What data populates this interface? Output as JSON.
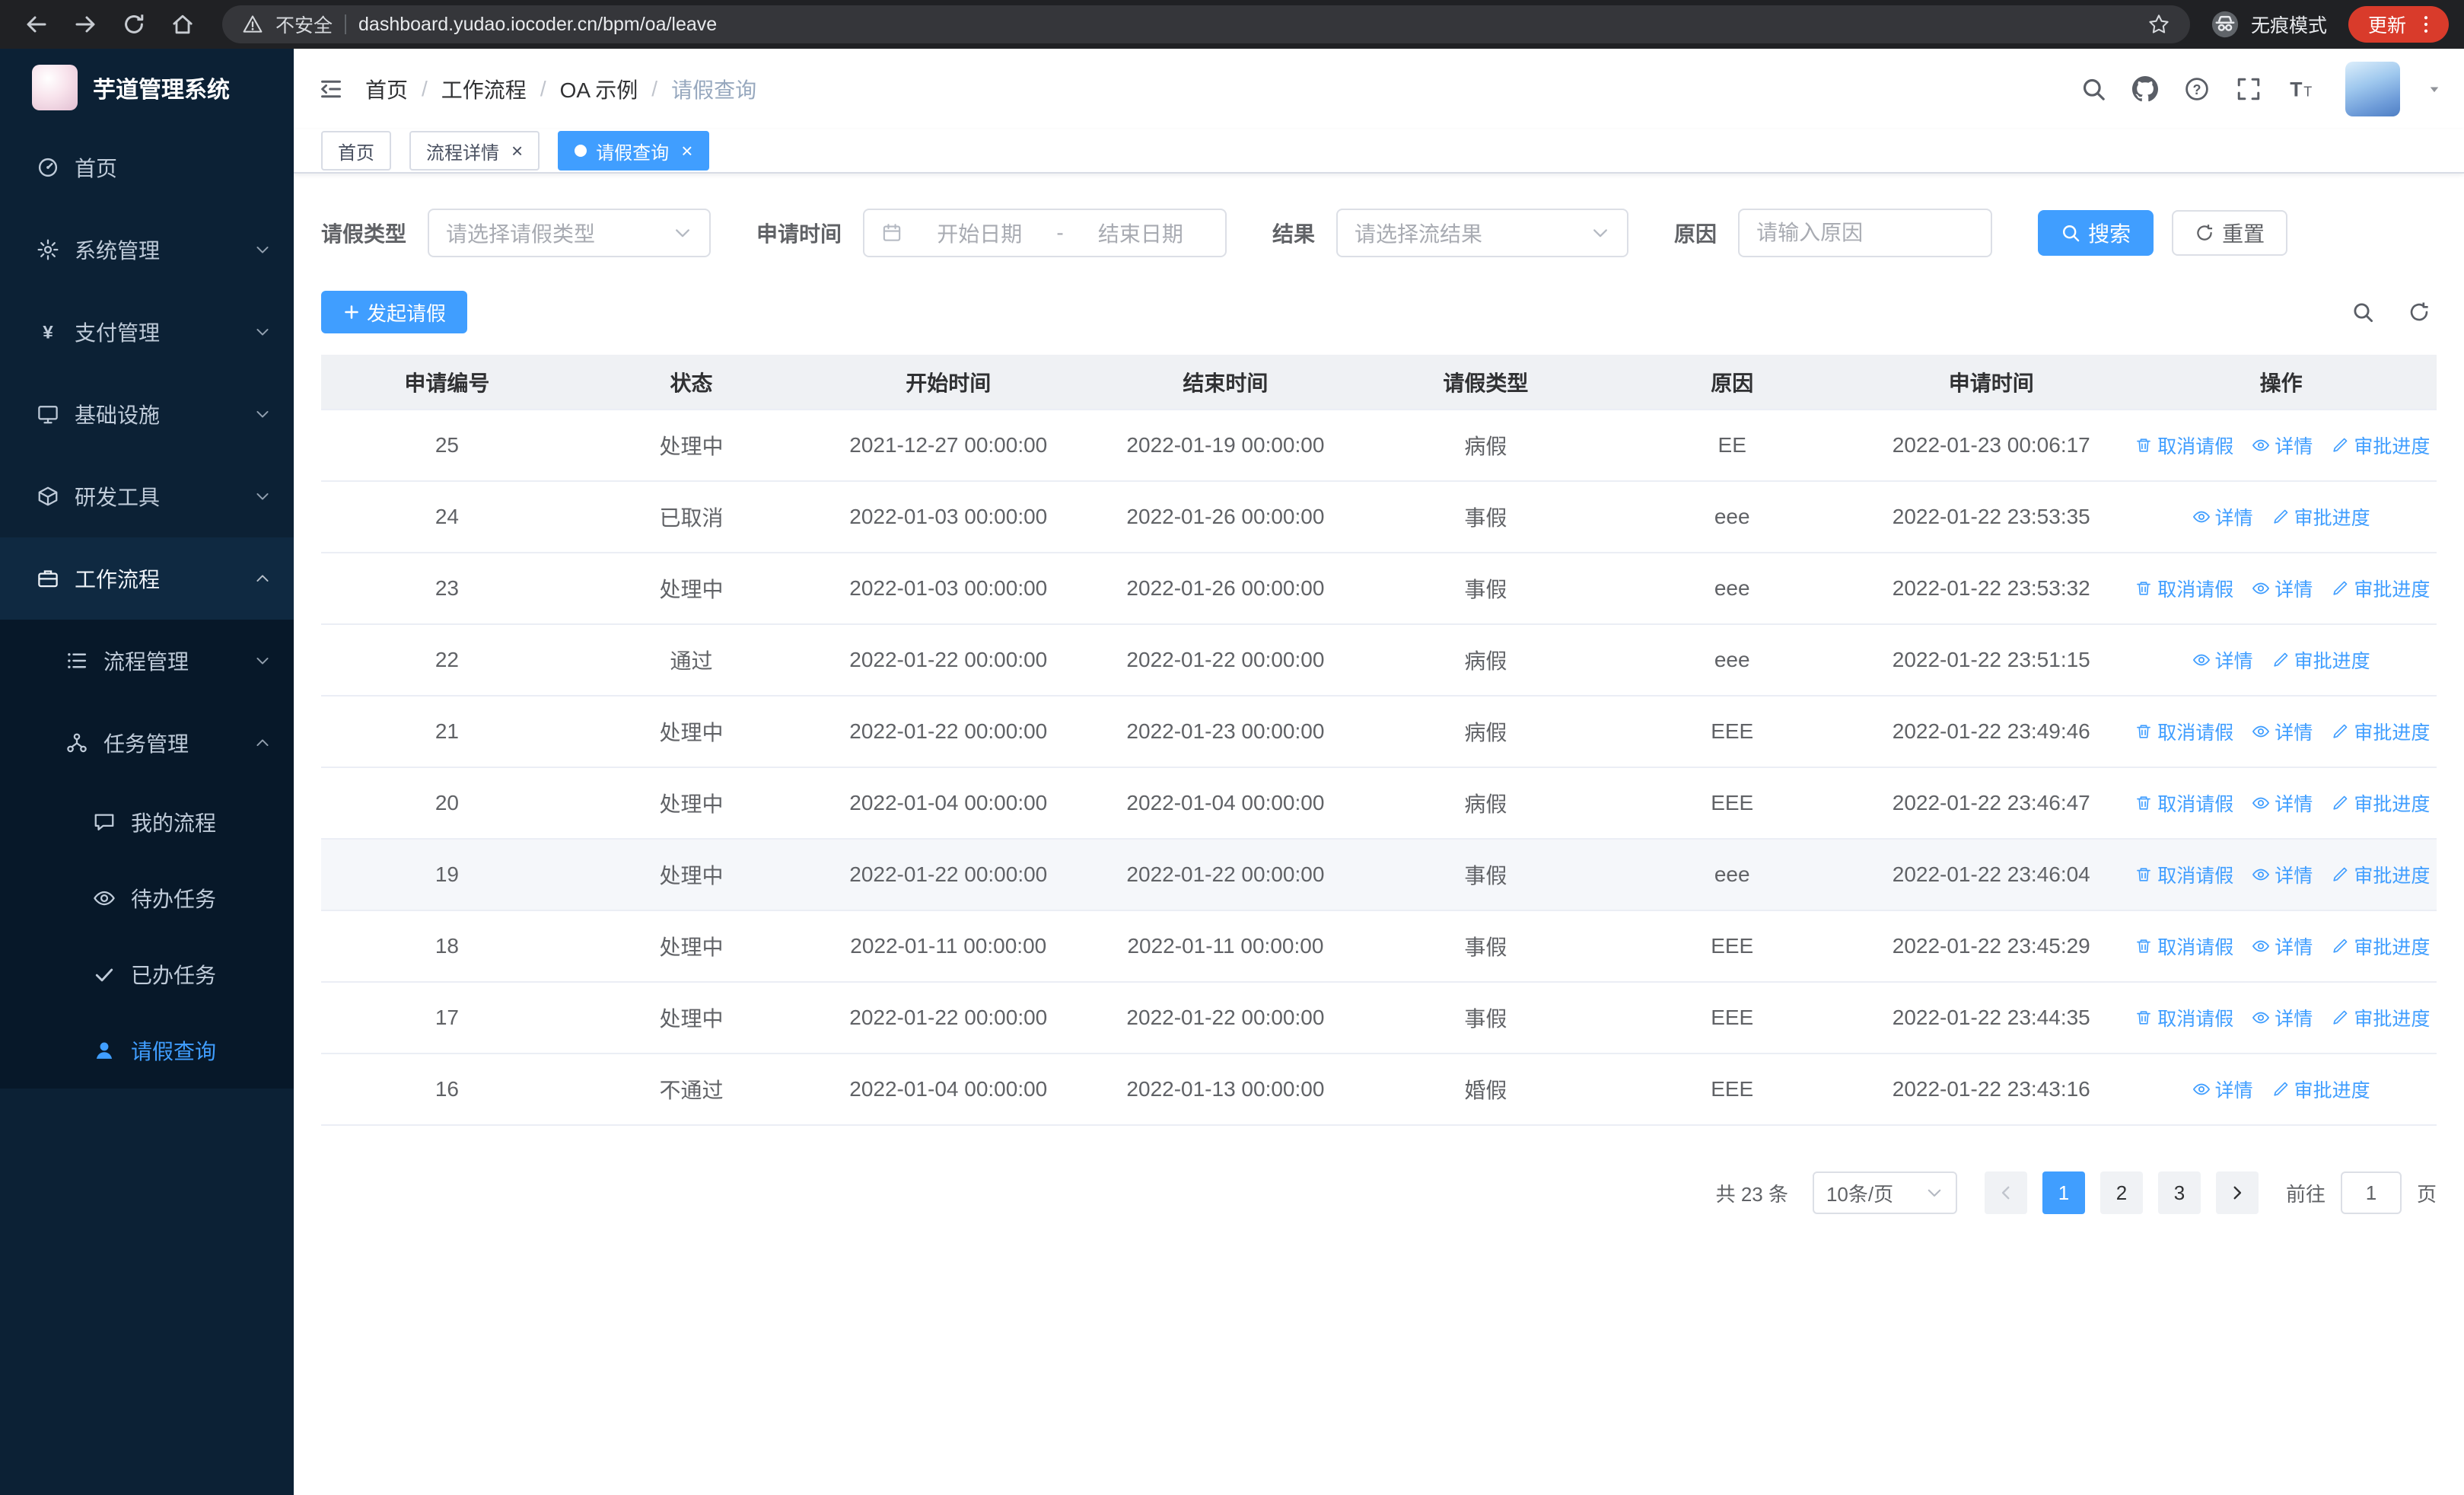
{
  "colors": {
    "primary": "#409eff",
    "sidebar_bg": "#0c2135",
    "sidebar_sub_bg": "#071829",
    "update_badge": "#d93b2b",
    "table_header_bg": "#eff1f4"
  },
  "browser": {
    "security_warning": "不安全",
    "url": "dashboard.yudao.iocoder.cn/bpm/oa/leave",
    "incognito_label": "无痕模式",
    "update_button": "更新"
  },
  "sidebar": {
    "app_title": "芋道管理系统",
    "menu": [
      {
        "label": "首页",
        "icon": "dashboard",
        "level": 0
      },
      {
        "label": "系统管理",
        "icon": "gear",
        "level": 0,
        "chevron": "down"
      },
      {
        "label": "支付管理",
        "icon": "yen",
        "level": 0,
        "chevron": "down"
      },
      {
        "label": "基础设施",
        "icon": "monitor",
        "level": 0,
        "chevron": "down"
      },
      {
        "label": "研发工具",
        "icon": "box",
        "level": 0,
        "chevron": "down"
      },
      {
        "label": "工作流程",
        "icon": "briefcase",
        "level": 0,
        "chevron": "up",
        "open": true
      },
      {
        "label": "流程管理",
        "icon": "list",
        "level": 1,
        "chevron": "down"
      },
      {
        "label": "任务管理",
        "icon": "task",
        "level": 1,
        "chevron": "up"
      },
      {
        "label": "我的流程",
        "icon": "chat",
        "level": 2
      },
      {
        "label": "待办任务",
        "icon": "eye",
        "level": 2
      },
      {
        "label": "已办任务",
        "icon": "check",
        "level": 2
      },
      {
        "label": "请假查询",
        "icon": "user",
        "level": 2,
        "active": true
      }
    ]
  },
  "header": {
    "breadcrumb": [
      "首页",
      "工作流程",
      "OA 示例",
      "请假查询"
    ]
  },
  "tabs": [
    {
      "label": "首页",
      "closable": false,
      "active": false
    },
    {
      "label": "流程详情",
      "closable": true,
      "active": false
    },
    {
      "label": "请假查询",
      "closable": true,
      "active": true
    }
  ],
  "filters": {
    "leave_type_label": "请假类型",
    "leave_type_placeholder": "请选择请假类型",
    "apply_time_label": "申请时间",
    "start_date_placeholder": "开始日期",
    "range_separator": "-",
    "end_date_placeholder": "结束日期",
    "result_label": "结果",
    "result_placeholder": "请选择流结果",
    "reason_label": "原因",
    "reason_placeholder": "请输入原因",
    "search_button": "搜索",
    "reset_button": "重置"
  },
  "toolbar": {
    "create_button": "发起请假"
  },
  "table": {
    "columns": [
      "申请编号",
      "状态",
      "开始时间",
      "结束时间",
      "请假类型",
      "原因",
      "申请时间",
      "操作"
    ],
    "action_defs": {
      "cancel": {
        "label": "取消请假",
        "icon": "trash"
      },
      "detail": {
        "label": "详情",
        "icon": "eye"
      },
      "progress": {
        "label": "审批进度",
        "icon": "edit"
      }
    },
    "rows": [
      {
        "id": "25",
        "status": "处理中",
        "start": "2021-12-27 00:00:00",
        "end": "2022-01-19 00:00:00",
        "type": "病假",
        "reason": "EE",
        "applied": "2022-01-23 00:06:17",
        "actions": [
          "cancel",
          "detail",
          "progress"
        ]
      },
      {
        "id": "24",
        "status": "已取消",
        "start": "2022-01-03 00:00:00",
        "end": "2022-01-26 00:00:00",
        "type": "事假",
        "reason": "eee",
        "applied": "2022-01-22 23:53:35",
        "actions": [
          "detail",
          "progress"
        ]
      },
      {
        "id": "23",
        "status": "处理中",
        "start": "2022-01-03 00:00:00",
        "end": "2022-01-26 00:00:00",
        "type": "事假",
        "reason": "eee",
        "applied": "2022-01-22 23:53:32",
        "actions": [
          "cancel",
          "detail",
          "progress"
        ]
      },
      {
        "id": "22",
        "status": "通过",
        "start": "2022-01-22 00:00:00",
        "end": "2022-01-22 00:00:00",
        "type": "病假",
        "reason": "eee",
        "applied": "2022-01-22 23:51:15",
        "actions": [
          "detail",
          "progress"
        ]
      },
      {
        "id": "21",
        "status": "处理中",
        "start": "2022-01-22 00:00:00",
        "end": "2022-01-23 00:00:00",
        "type": "病假",
        "reason": "EEE",
        "applied": "2022-01-22 23:49:46",
        "actions": [
          "cancel",
          "detail",
          "progress"
        ]
      },
      {
        "id": "20",
        "status": "处理中",
        "start": "2022-01-04 00:00:00",
        "end": "2022-01-04 00:00:00",
        "type": "病假",
        "reason": "EEE",
        "applied": "2022-01-22 23:46:47",
        "actions": [
          "cancel",
          "detail",
          "progress"
        ]
      },
      {
        "id": "19",
        "status": "处理中",
        "start": "2022-01-22 00:00:00",
        "end": "2022-01-22 00:00:00",
        "type": "事假",
        "reason": "eee",
        "applied": "2022-01-22 23:46:04",
        "actions": [
          "cancel",
          "detail",
          "progress"
        ],
        "highlight": true
      },
      {
        "id": "18",
        "status": "处理中",
        "start": "2022-01-11 00:00:00",
        "end": "2022-01-11 00:00:00",
        "type": "事假",
        "reason": "EEE",
        "applied": "2022-01-22 23:45:29",
        "actions": [
          "cancel",
          "detail",
          "progress"
        ]
      },
      {
        "id": "17",
        "status": "处理中",
        "start": "2022-01-22 00:00:00",
        "end": "2022-01-22 00:00:00",
        "type": "事假",
        "reason": "EEE",
        "applied": "2022-01-22 23:44:35",
        "actions": [
          "cancel",
          "detail",
          "progress"
        ]
      },
      {
        "id": "16",
        "status": "不通过",
        "start": "2022-01-04 00:00:00",
        "end": "2022-01-13 00:00:00",
        "type": "婚假",
        "reason": "EEE",
        "applied": "2022-01-22 23:43:16",
        "actions": [
          "detail",
          "progress"
        ]
      }
    ]
  },
  "pagination": {
    "total_text": "共 23 条",
    "page_size": "10条/页",
    "pages": [
      "1",
      "2",
      "3"
    ],
    "active_page": "1",
    "goto_label": "前往",
    "goto_value": "1",
    "page_unit": "页"
  }
}
